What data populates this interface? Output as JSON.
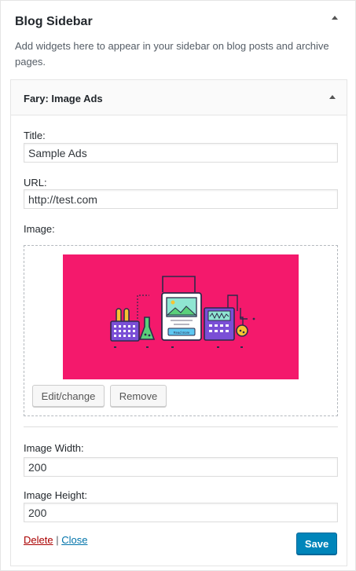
{
  "sidebar_panel": {
    "title": "Blog Sidebar",
    "description": "Add widgets here to appear in your sidebar on blog posts and archive pages."
  },
  "widget": {
    "title": "Fary: Image Ads",
    "title_field": {
      "label": "Title:",
      "value": "Sample Ads"
    },
    "url_field": {
      "label": "URL:",
      "value": "http://test.com"
    },
    "image_label": "Image:",
    "image_preview": {
      "background": "#f4196c",
      "button_text": "Read more"
    },
    "edit_change_label": "Edit/change",
    "remove_label": "Remove",
    "width_field": {
      "label": "Image Width:",
      "value": "200"
    },
    "height_field": {
      "label": "Image Height:",
      "value": "200"
    },
    "delete_label": "Delete",
    "separator": "|",
    "close_label": "Close",
    "save_label": "Save"
  },
  "colors": {
    "primary_button": "#0085ba",
    "delete_link": "#aa0000",
    "close_link": "#0073aa"
  }
}
